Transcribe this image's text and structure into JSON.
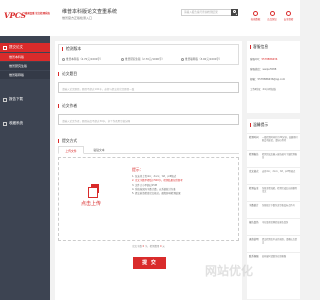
{
  "header": {
    "logo_text": "VPCS",
    "logo_sub": "维普查重 论文检测系统",
    "system_title": "维普本科版论文查重系统",
    "system_sub": "维普官方正版检测入口",
    "search_placeholder": "请输入报告编号查询检测结果",
    "badges": [
      {
        "label": "权威数据"
      },
      {
        "label": "正品保证"
      },
      {
        "label": "安全保密"
      }
    ]
  },
  "sidebar": {
    "items": [
      {
        "label": "提交论文"
      },
      {
        "label": "维普本科版"
      },
      {
        "label": "维普研究生版"
      },
      {
        "label": "维普职称版"
      },
      {
        "label": "报告下载"
      },
      {
        "label": "收藏系统"
      }
    ]
  },
  "main": {
    "section_select": {
      "title": "检测版本",
      "options": [
        {
          "label": "维普本科版（2.70元/1000字）"
        },
        {
          "label": "维普研究生版（2.70元/1000字）"
        },
        {
          "label": "维普职称版（3.00元/1000字）"
        }
      ]
    },
    "title_field": {
      "label": "论文题目",
      "placeholder": "请输入论文题目，题目不超过100字，必须与提交的论文题目一致"
    },
    "author_field": {
      "label": "论文作者",
      "placeholder": "请输入论文作者，题目长度不超过30字，多个作者用空格分隔"
    },
    "submit_method": {
      "title": "提交方式",
      "tabs": [
        {
          "label": "上传文件"
        },
        {
          "label": "粘贴文本"
        }
      ]
    },
    "upload": {
      "label": "点击上传",
      "tips_heading": "提示：",
      "tips": [
        "1. 仅支持上传doc、docx、txt、pdf格式",
        "2. 论文字数不得低于500字，检测结果仅供参考",
        "3. 文件大小不超过15M",
        "4. 系统按实际字数计费，以系统统计为准",
        "5. 提交前请检查论文格式，避免影响检测结果"
      ]
    },
    "cost": {
      "prefix": "论文字数",
      "count": "0",
      "middle": "字，检测费用",
      "price": "0",
      "suffix": "元"
    },
    "submit_label": "提 交"
  },
  "right": {
    "service": {
      "title": "客服信息",
      "rows": [
        {
          "k": "客服QQ：",
          "v": "5578886636"
        },
        {
          "k": "客服微信：",
          "v": "weipu5588"
        },
        {
          "k": "邮箱：",
          "v": "5578886636@qq.com"
        },
        {
          "k": "工作时间：",
          "v": "24小时在线"
        }
      ]
    },
    "hints": {
      "title": "温馨提示",
      "rows": [
        {
          "k": "检测时间",
          "v": "一般检测时间约为30分钟，高峰期可能会有延迟，请耐心等待"
        },
        {
          "k": "检测报告",
          "v": "检测完成后输入报告编号下载检测报告"
        },
        {
          "k": "论文格式",
          "v": "支持doc、docx、txt、pdf等格式"
        },
        {
          "k": "检测安全",
          "v": "系统全程加密，检测完成后自动删除论文"
        },
        {
          "k": "字数统计",
          "v": "系统统计字数包含空格及标点符号"
        },
        {
          "k": "报告真伪",
          "v": "可在维普官网验证报告真伪"
        },
        {
          "k": "退款说明",
          "v": "提交检测后不支持退款，请确认后提交"
        },
        {
          "k": "联系客服",
          "v": "如有疑问请联系在线客服"
        }
      ]
    }
  },
  "watermark": "网站优化"
}
